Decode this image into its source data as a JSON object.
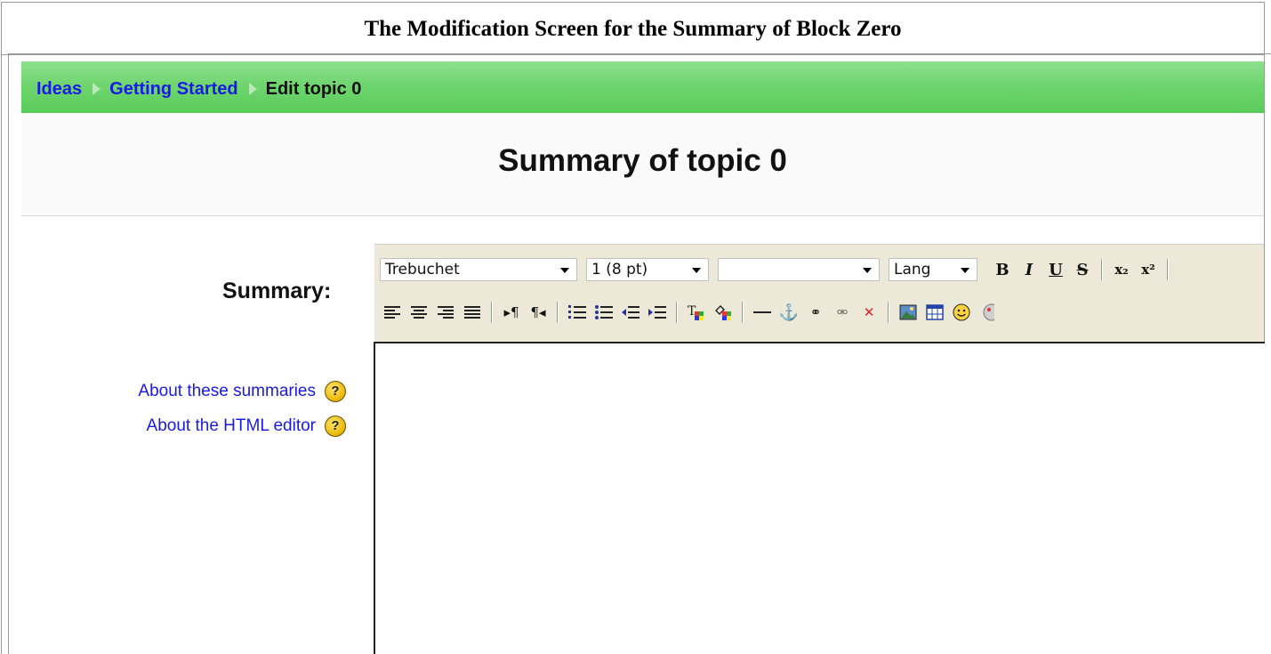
{
  "caption": "The Modification Screen for the Summary of Block Zero",
  "breadcrumb": {
    "items": [
      {
        "label": "Ideas"
      },
      {
        "label": "Getting Started"
      }
    ],
    "current": "Edit topic 0"
  },
  "page_title": "Summary of topic 0",
  "form": {
    "summary_label": "Summary:",
    "help_links": [
      {
        "label": "About these summaries",
        "icon": "help-icon"
      },
      {
        "label": "About the HTML editor",
        "icon": "help-icon"
      }
    ]
  },
  "toolbar": {
    "font_family": "Trebuchet",
    "font_size": "1 (8 pt)",
    "format": "",
    "lang": "Lang",
    "row1_buttons": [
      {
        "name": "bold-icon",
        "glyph": "B"
      },
      {
        "name": "italic-icon",
        "glyph": "I"
      },
      {
        "name": "underline-icon",
        "glyph": "U"
      },
      {
        "name": "strikethrough-icon",
        "glyph": "S"
      },
      {
        "name": "subscript-icon",
        "glyph": "x₂"
      },
      {
        "name": "superscript-icon",
        "glyph": "x²"
      }
    ],
    "row2_icons": [
      "align-left-icon",
      "align-center-icon",
      "align-right-icon",
      "justify-icon",
      "ltr-icon",
      "rtl-icon",
      "ordered-list-icon",
      "unordered-list-icon",
      "outdent-icon",
      "indent-icon",
      "text-color-icon",
      "background-color-icon",
      "horizontal-rule-icon",
      "anchor-icon",
      "link-icon",
      "unlink-icon",
      "nolink-icon",
      "image-icon",
      "table-icon",
      "smiley-icon",
      "special-char-icon"
    ]
  },
  "colors": {
    "nav_green": "#6fd66f",
    "link_blue": "#1a1ae6",
    "toolbar_bg": "#ece9d8"
  }
}
